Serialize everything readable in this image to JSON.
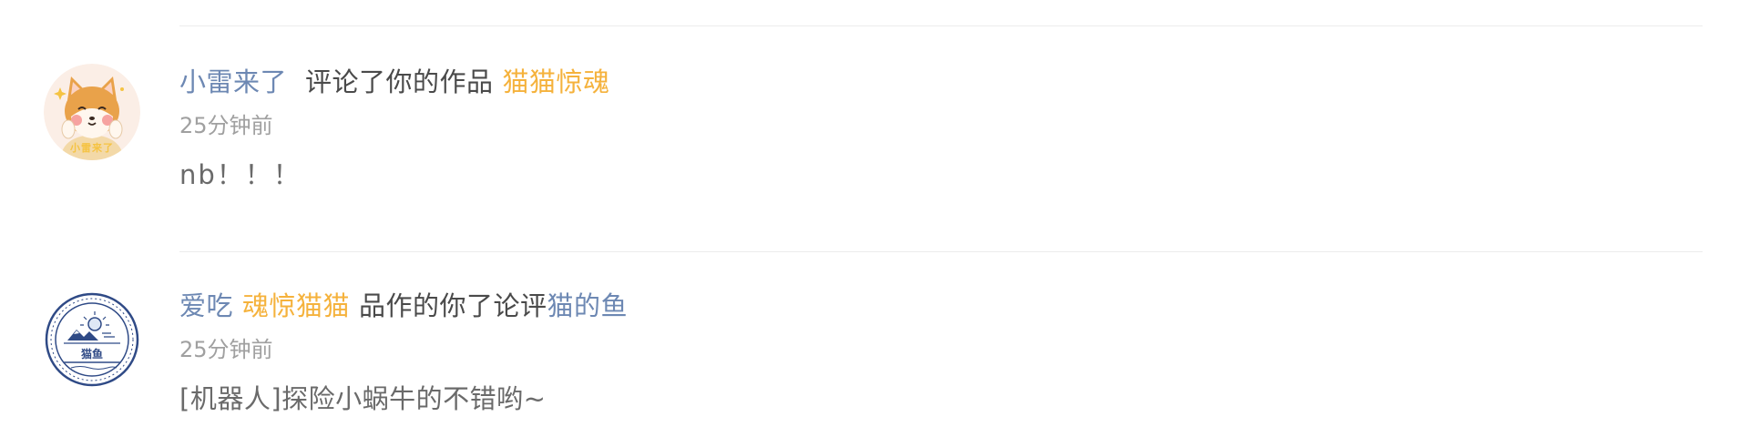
{
  "comments": [
    {
      "user": "小雷来了",
      "action": "评论了你的作品",
      "work": "猫猫惊魂",
      "time": "25分钟前",
      "content": "nb！！！",
      "avatar_icon": "shiba-dog-icon",
      "avatar_badge": "小雷来了"
    },
    {
      "prefix": "爱吃",
      "work": "魂惊猫猫",
      "action": "品作的你了论评",
      "user": "猫的鱼",
      "time": "25分钟前",
      "content": "[机器人]探险小蜗牛的不错哟~",
      "avatar_icon": "fish-cat-logo-icon",
      "avatar_badge": "猫鱼"
    }
  ],
  "colors": {
    "user_link": "#6d88b3",
    "work_link": "#f5b23c",
    "body_text": "#4a4a4a",
    "muted": "#a0a0a0",
    "divider": "#ececec"
  }
}
